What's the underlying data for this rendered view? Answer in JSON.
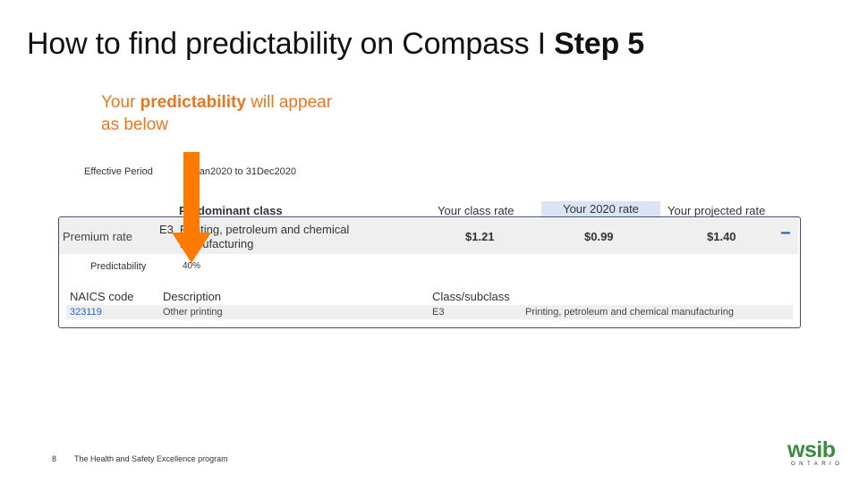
{
  "slide": {
    "title_main": "How to find predictability on Compass I ",
    "title_bold": "Step 5"
  },
  "callout": {
    "prefix": "Your ",
    "bold": "predictability",
    "suffix": " will appear as below"
  },
  "effective": {
    "label": "Effective Period",
    "value": "01Jan2020 to 31Dec2020"
  },
  "headers": {
    "predominant_class": "Predominant class",
    "your_class_rate": "Your class rate",
    "your_2020_rate": "Your 2020 rate",
    "your_projected_rate": "Your projected rate"
  },
  "premium": {
    "label": "Premium rate",
    "class_code": "E3",
    "class_desc": "Printing, petroleum and chemical manufacturing",
    "class_rate": "$1.21",
    "rate_2020": "$0.99",
    "projected_rate": "$1.40",
    "collapse_symbol": "−"
  },
  "predictability": {
    "label": "Predictability",
    "value": "40%"
  },
  "naics": {
    "headers": {
      "code": "NAICS code",
      "description": "Description",
      "class": "Class/subclass"
    },
    "row": {
      "code": "323119",
      "description": "Other printing",
      "class": "E3",
      "subclass": "Printing, petroleum and chemical manufacturing"
    }
  },
  "footer": {
    "page_number": "8",
    "text": "The Health and Safety Excellence program"
  },
  "logo": {
    "word": "wsib",
    "sub": "ONTARIO"
  },
  "colors": {
    "accent_orange": "#e87722",
    "arrow_orange": "#ff7a00",
    "highlight_blue": "#dce3f3",
    "link_blue": "#2b64c5",
    "wsib_green": "#3a8c3f"
  }
}
